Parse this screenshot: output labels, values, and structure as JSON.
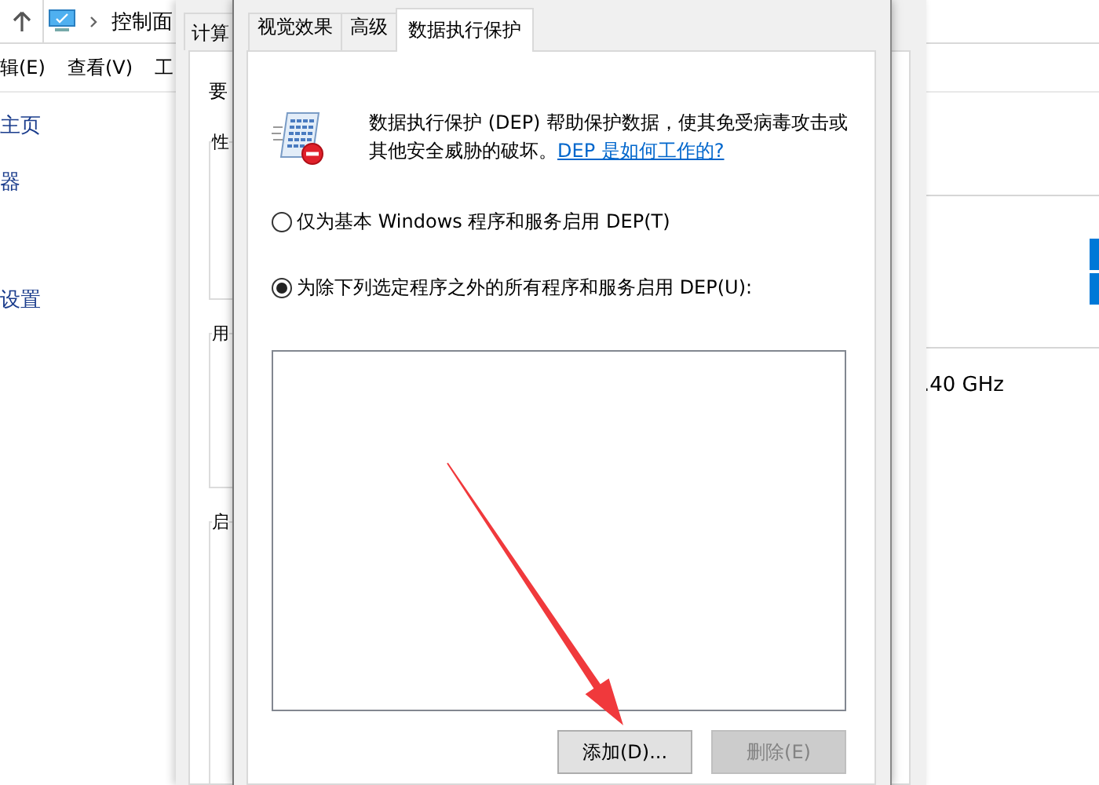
{
  "control_panel": {
    "breadcrumb": "控制面",
    "menu": [
      "辑(E)",
      "查看(V)",
      "工"
    ],
    "sidebar_links": [
      "主页",
      "器",
      "设置"
    ],
    "info_value": ".40 GHz"
  },
  "system_properties": {
    "tab": "计算",
    "section_label": "要",
    "group_labels": [
      "性",
      "用",
      "启"
    ]
  },
  "dialog": {
    "tabs": [
      {
        "label": "视觉效果",
        "selected": false
      },
      {
        "label": "高级",
        "selected": false
      },
      {
        "label": "数据执行保护",
        "selected": true
      }
    ],
    "description": "数据执行保护 (DEP) 帮助保护数据，使其免受病毒攻击或其他安全威胁的破坏。",
    "link": "DEP 是如何工作的?",
    "options": [
      {
        "label": "仅为基本 Windows 程序和服务启用 DEP(T)",
        "selected": false
      },
      {
        "label": "为除下列选定程序之外的所有程序和服务启用 DEP(U):",
        "selected": true
      }
    ],
    "buttons": [
      {
        "label": "添加(D)...",
        "disabled": false
      },
      {
        "label": "删除(E)",
        "disabled": true
      }
    ]
  }
}
